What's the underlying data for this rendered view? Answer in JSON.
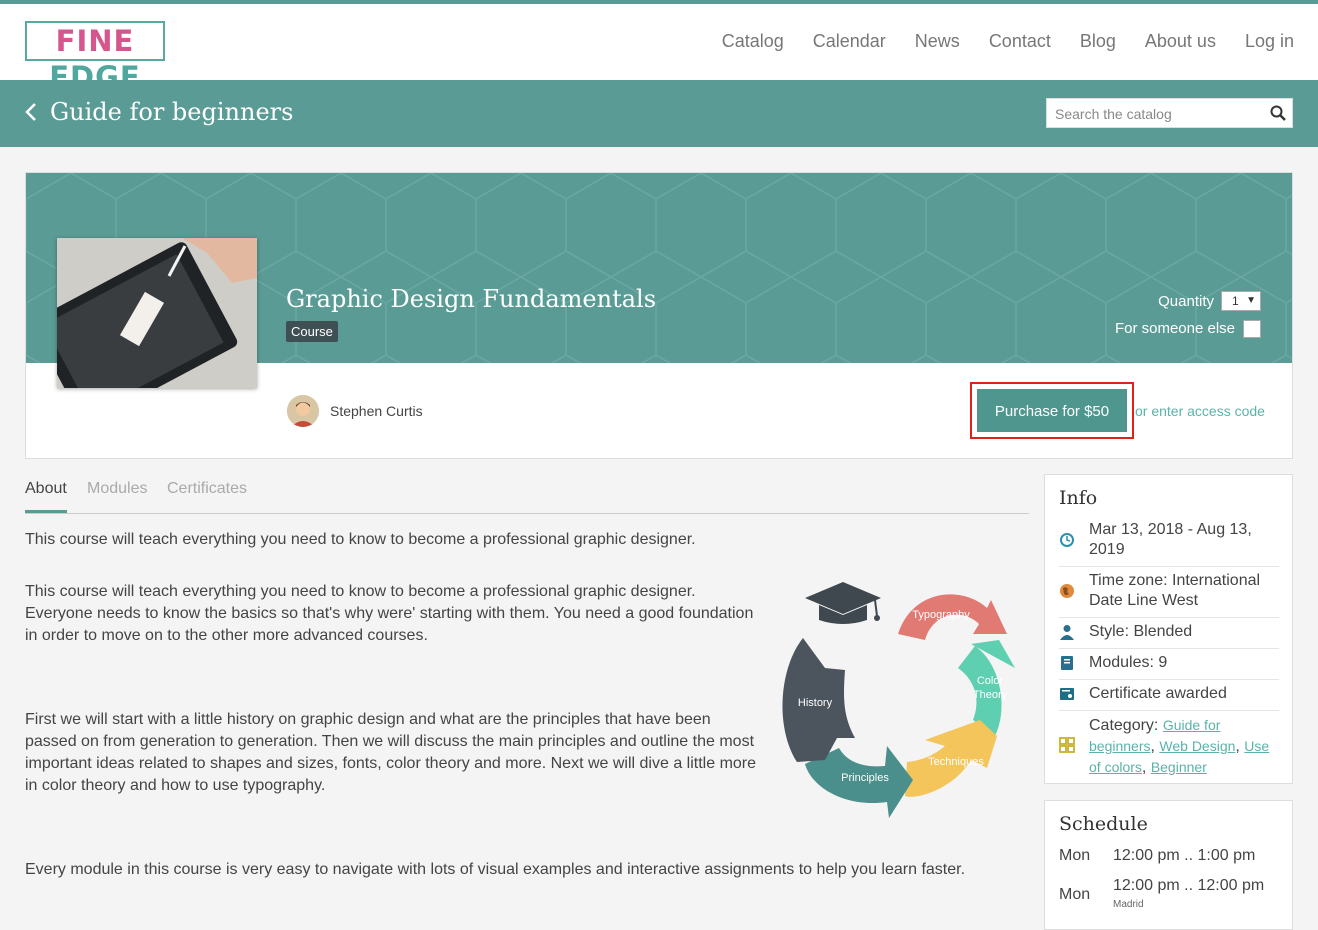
{
  "logo": {
    "part1": "FINE",
    "part2": "EDGE"
  },
  "nav": [
    "Catalog",
    "Calendar",
    "News",
    "Contact",
    "Blog",
    "About us",
    "Log in"
  ],
  "bar": {
    "title": "Guide for beginners",
    "search_placeholder": "Search the catalog"
  },
  "course": {
    "title": "Graphic Design Fundamentals",
    "badge": "Course",
    "quantity_label": "Quantity",
    "quantity_value": "1",
    "someone_else_label": "For someone else",
    "author": "Stephen Curtis",
    "purchase_label": "Purchase for $50",
    "access_link": "or enter access code"
  },
  "tabs": [
    "About",
    "Modules",
    "Certificates"
  ],
  "about": {
    "p1": "This course will teach everything you need to know to become a professional graphic designer.",
    "p2": "This course will teach everything you need to know to become a professional graphic designer. Everyone needs to know the basics so that's why were' starting with them. You need a good foundation in order to move on to the other more advanced courses.",
    "p3": "First we will start with a little history on graphic design and what are the principles that have been passed on from generation to generation. Then we will discuss the main principles and outline the most important ideas related to shapes and sizes, fonts, color theory and more. Next we will dive a little more in color theory and how to use typography.",
    "p4": "Every module in this course is very easy to navigate with lots of visual examples and interactive assignments to help you learn faster."
  },
  "diagram": {
    "labels": {
      "typography": "Typography",
      "color1": "Color",
      "color2": "Theory",
      "techniques": "Techniques",
      "principles": "Principles",
      "history": "History"
    },
    "colors": {
      "typography": "#e27a74",
      "color": "#5fcfb1",
      "techniques": "#f3c55a",
      "principles": "#4a8f8b",
      "history": "#4c555e"
    }
  },
  "info": {
    "title": "Info",
    "dates": "Mar 13, 2018 - Aug 13, 2019",
    "timezone": "Time zone: International Date Line West",
    "style": "Style: Blended",
    "modules": "Modules: 9",
    "certificate": "Certificate awarded",
    "category_label": "Category: ",
    "categories": [
      "Guide for beginners",
      "Web Design",
      "Use of colors",
      "Beginner"
    ]
  },
  "schedule": {
    "title": "Schedule",
    "rows": [
      {
        "day": "Mon",
        "time": "12:00 pm .. 1:00 pm",
        "tz": ""
      },
      {
        "day": "Mon",
        "time": "12:00 pm .. 12:00 pm",
        "tz": "Madrid"
      }
    ]
  },
  "colors": {
    "teal": "#5a9c95",
    "accent_link": "#5ab3aa",
    "highlight": "#e0201b"
  }
}
